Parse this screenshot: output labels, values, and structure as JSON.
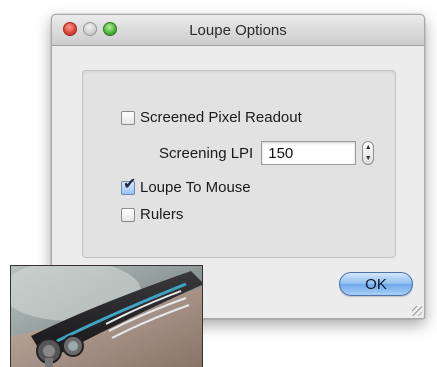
{
  "window": {
    "title": "Loupe Options"
  },
  "options": {
    "screened_pixel_readout": {
      "label": "Screened Pixel Readout",
      "checked": false
    },
    "screening_lpi": {
      "label": "Screening LPI",
      "value": "150"
    },
    "loupe_to_mouse": {
      "label": "Loupe To Mouse",
      "checked": true
    },
    "rulers": {
      "label": "Rulers",
      "checked": false
    }
  },
  "buttons": {
    "ok_label": "OK"
  },
  "icons": {
    "close": "close-traffic-light-icon",
    "minimize": "minimize-traffic-light-icon",
    "zoom": "zoom-traffic-light-icon",
    "stepper_up": "stepper-up-arrow-icon",
    "stepper_down": "stepper-down-arrow-icon",
    "checkmark": "checkmark-icon",
    "resize": "resize-grip-icon"
  },
  "colors": {
    "close": "#e2463c",
    "minimize": "#cfcfcf",
    "zoom": "#4fb83a",
    "default_button": "#8fbdf0",
    "window_bg": "#ececec"
  }
}
